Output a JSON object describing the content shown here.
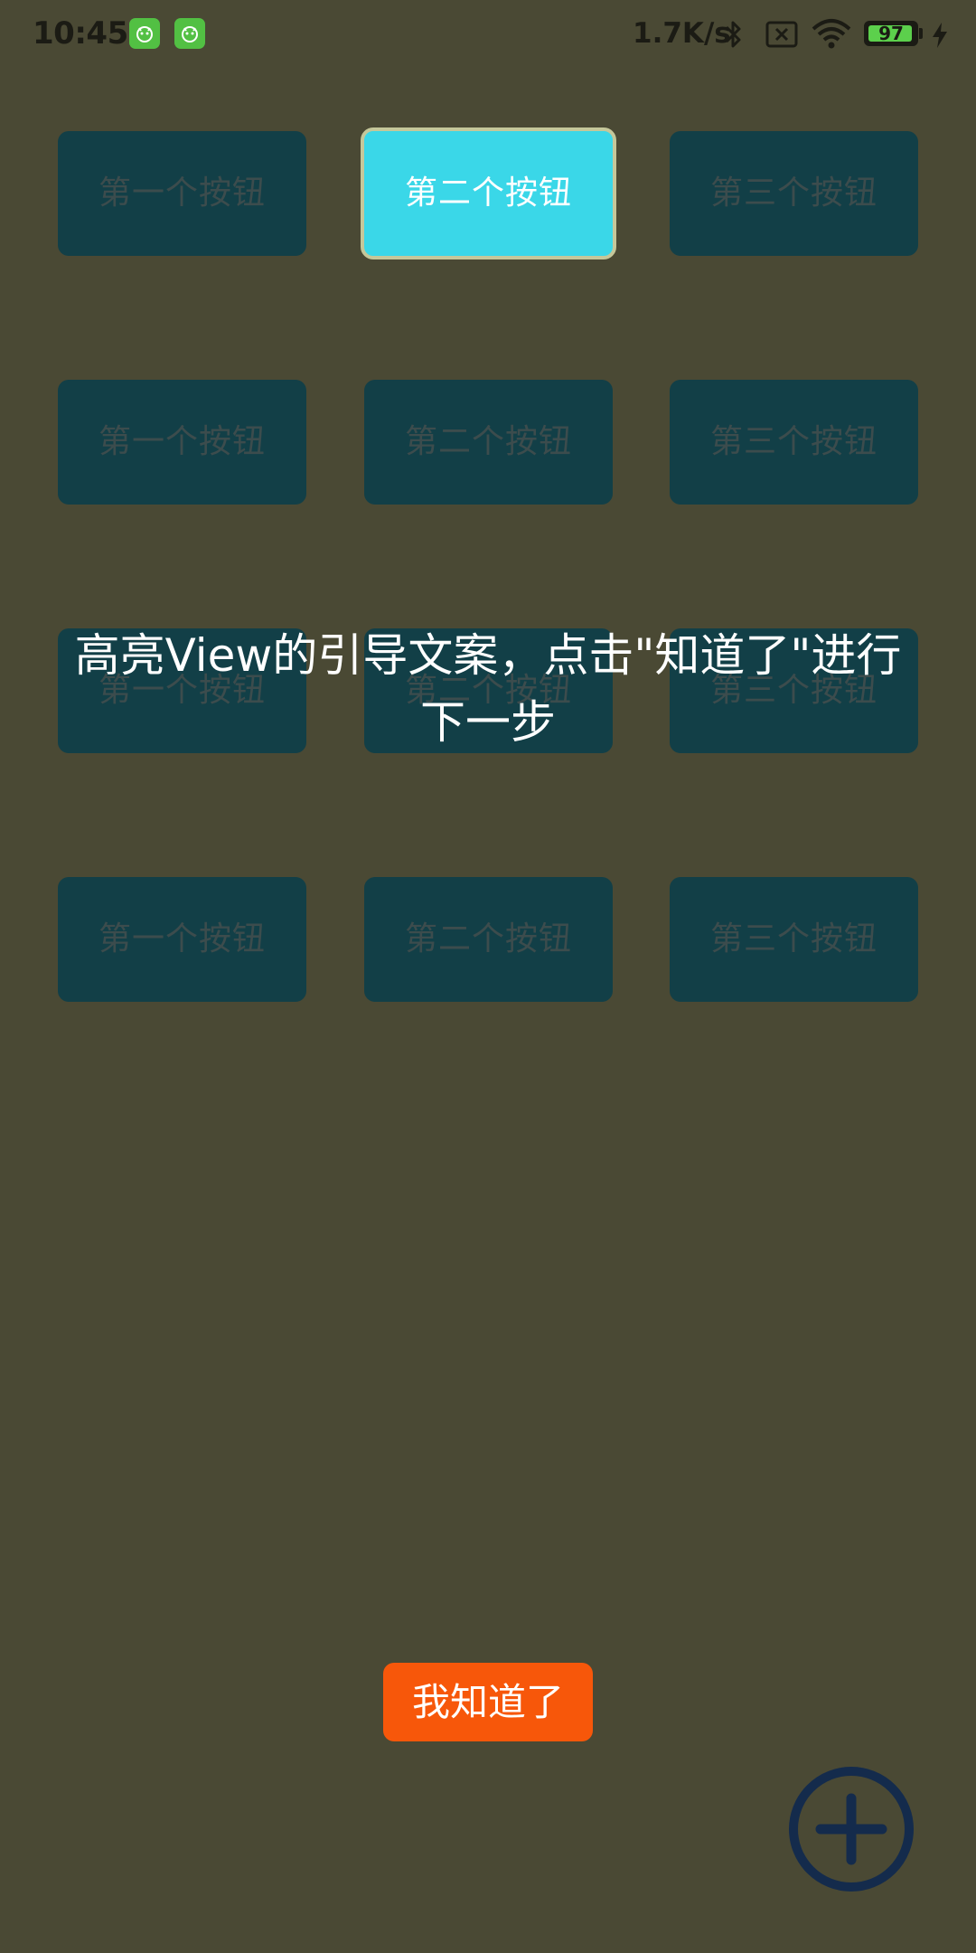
{
  "status_bar": {
    "time": "10:45",
    "net_speed": "1.7K/s",
    "battery_level": "97",
    "battery_percent": 97,
    "icons": [
      "app-badge-icon",
      "app-badge-icon",
      "bluetooth-icon",
      "no-sim-icon",
      "wifi-icon",
      "battery-icon",
      "charging-icon"
    ]
  },
  "grid": {
    "rows": [
      {
        "buttons": [
          {
            "label": "第一个按钮"
          },
          {
            "label": "第二个按钮"
          },
          {
            "label": "第三个按钮"
          }
        ]
      },
      {
        "buttons": [
          {
            "label": "第一个按钮"
          },
          {
            "label": "第二个按钮"
          },
          {
            "label": "第三个按钮"
          }
        ]
      },
      {
        "buttons": [
          {
            "label": "第一个按钮"
          },
          {
            "label": "第二个按钮"
          },
          {
            "label": "第三个按钮"
          }
        ]
      },
      {
        "buttons": [
          {
            "label": "第一个按钮"
          },
          {
            "label": "第二个按钮"
          },
          {
            "label": "第三个按钮"
          }
        ]
      }
    ],
    "highlighted": "第二个按钮"
  },
  "guide": {
    "line1": "高亮View的引导文案，点击\"知道了\"进行",
    "line2": "下一步"
  },
  "confirm_button": {
    "label": "我知道了"
  },
  "fab": {
    "icon": "plus-icon"
  },
  "colors": {
    "overlay_background": "#4a4934",
    "button_dim": "#123f47",
    "button_highlight": "#3ad7e8",
    "confirm": "#f7570a",
    "fab_ring": "#142b4c"
  }
}
